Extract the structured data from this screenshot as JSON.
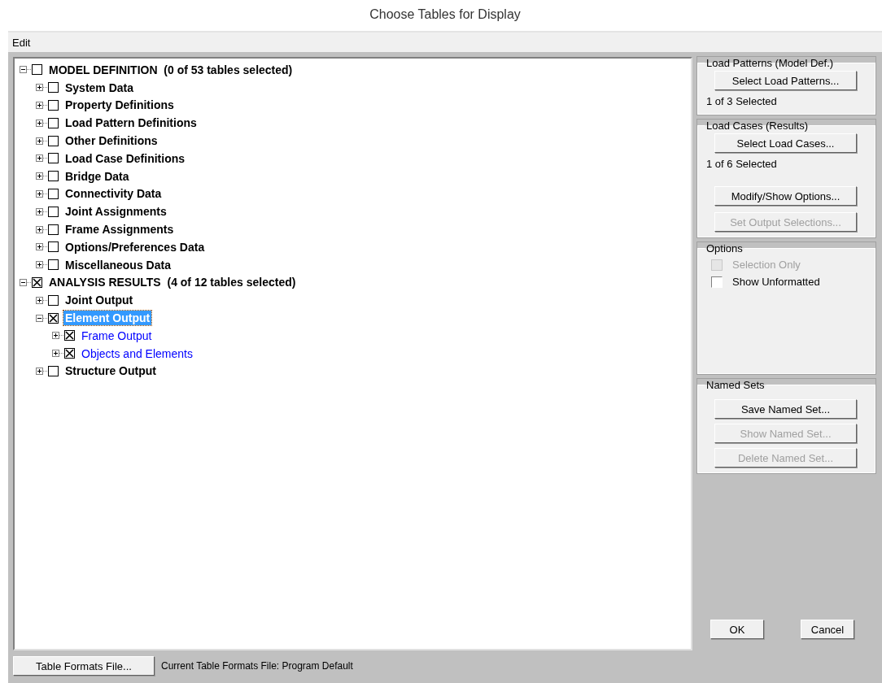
{
  "window": {
    "title": "Choose Tables for Display"
  },
  "menu": [
    {
      "label": "Edit"
    }
  ],
  "tree": [
    {
      "label": "MODEL DEFINITION  (0 of 53 tables selected)",
      "kind": "category",
      "expanded": true,
      "checked": false,
      "selected": false,
      "children": [
        {
          "label": "System Data",
          "kind": "category",
          "expanded": false,
          "checked": false,
          "selected": false
        },
        {
          "label": "Property Definitions",
          "kind": "category",
          "expanded": false,
          "checked": false,
          "selected": false
        },
        {
          "label": "Load Pattern Definitions",
          "kind": "category",
          "expanded": false,
          "checked": false,
          "selected": false
        },
        {
          "label": "Other Definitions",
          "kind": "category",
          "expanded": false,
          "checked": false,
          "selected": false
        },
        {
          "label": "Load Case Definitions",
          "kind": "category",
          "expanded": false,
          "checked": false,
          "selected": false
        },
        {
          "label": "Bridge Data",
          "kind": "category",
          "expanded": false,
          "checked": false,
          "selected": false
        },
        {
          "label": "Connectivity Data",
          "kind": "category",
          "expanded": false,
          "checked": false,
          "selected": false
        },
        {
          "label": "Joint Assignments",
          "kind": "category",
          "expanded": false,
          "checked": false,
          "selected": false
        },
        {
          "label": "Frame Assignments",
          "kind": "category",
          "expanded": false,
          "checked": false,
          "selected": false
        },
        {
          "label": "Options/Preferences Data",
          "kind": "category",
          "expanded": false,
          "checked": false,
          "selected": false
        },
        {
          "label": "Miscellaneous Data",
          "kind": "category",
          "expanded": false,
          "checked": false,
          "selected": false
        }
      ]
    },
    {
      "label": "ANALYSIS RESULTS  (4 of 12 tables selected)",
      "kind": "category",
      "expanded": true,
      "checked": true,
      "selected": false,
      "children": [
        {
          "label": "Joint Output",
          "kind": "category",
          "expanded": false,
          "checked": false,
          "selected": false
        },
        {
          "label": "Element Output",
          "kind": "category",
          "expanded": true,
          "checked": true,
          "selected": true,
          "children": [
            {
              "label": "Frame Output",
              "kind": "table",
              "expanded": false,
              "checked": true,
              "selected": false
            },
            {
              "label": "Objects and Elements",
              "kind": "table",
              "expanded": false,
              "checked": true,
              "selected": false
            }
          ]
        },
        {
          "label": "Structure Output",
          "kind": "category",
          "expanded": false,
          "checked": false,
          "selected": false
        }
      ]
    }
  ],
  "load_patterns": {
    "title": "Load Patterns (Model Def.)",
    "button": {
      "label": "Select Load Patterns...",
      "disabled": false
    },
    "status": "1 of 3 Selected"
  },
  "load_cases": {
    "title": "Load Cases (Results)",
    "button": {
      "label": "Select Load Cases...",
      "disabled": false
    },
    "status": "1 of 6 Selected",
    "buttons": [
      {
        "label": "Modify/Show Options...",
        "disabled": false
      },
      {
        "label": "Set Output Selections...",
        "disabled": true
      }
    ]
  },
  "options": {
    "title": "Options",
    "checkboxes": [
      {
        "label": "Selection Only",
        "checked": false,
        "disabled": true
      },
      {
        "label": "Show Unformatted",
        "checked": false,
        "disabled": false
      }
    ]
  },
  "named_sets": {
    "title": "Named Sets",
    "buttons": [
      {
        "label": "Save Named Set...",
        "disabled": false
      },
      {
        "label": "Show Named Set...",
        "disabled": true
      },
      {
        "label": "Delete Named Set...",
        "disabled": true
      }
    ]
  },
  "dialog_buttons": [
    {
      "label": "OK"
    },
    {
      "label": "Cancel"
    }
  ],
  "footer": {
    "button": "Table Formats File...",
    "text": "Current Table Formats File:  Program Default"
  }
}
